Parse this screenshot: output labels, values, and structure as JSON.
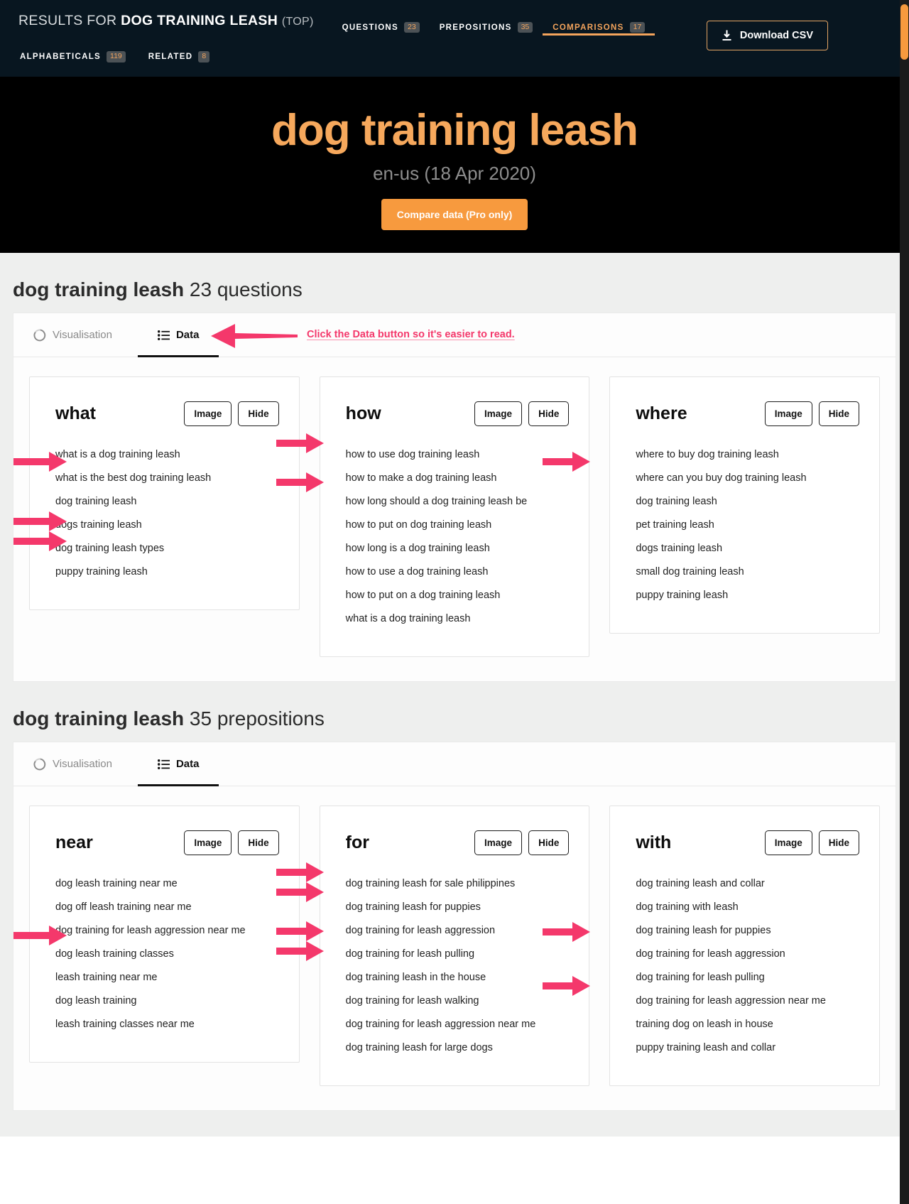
{
  "topbar": {
    "results_prefix": "RESULTS FOR",
    "results_keyword": "DOG TRAINING LEASH",
    "results_suffix": "(TOP)",
    "tabs": [
      {
        "label": "QUESTIONS",
        "count": "23",
        "active": false
      },
      {
        "label": "PREPOSITIONS",
        "count": "35",
        "active": false
      },
      {
        "label": "COMPARISONS",
        "count": "17",
        "active": true
      }
    ],
    "subtabs": [
      {
        "label": "ALPHABETICALS",
        "count": "119"
      },
      {
        "label": "RELATED",
        "count": "8"
      }
    ],
    "download_label": "Download CSV",
    "download_icon": "download-icon",
    "accent_color": "#f4a45c",
    "background_color": "#081620"
  },
  "hero": {
    "title": "dog training leash",
    "locale": "en-us (18 Apr 2020)",
    "compare_label": "Compare data (Pro only)",
    "title_color": "#f6a85c",
    "button_color": "#f79a3e",
    "background_color": "#000000"
  },
  "annotation": {
    "text": "Click the Data button so it's easier to read.",
    "color": "#f4386b"
  },
  "sections": [
    {
      "heading_keyword": "dog training leash",
      "heading_rest": "23 questions",
      "tabs": [
        {
          "label": "Visualisation",
          "icon": "visualisation-icon",
          "active": false
        },
        {
          "label": "Data",
          "icon": "list-icon",
          "active": true
        }
      ],
      "cards": [
        {
          "title": "what",
          "image_label": "Image",
          "hide_label": "Hide",
          "items": [
            "what is a dog training leash",
            "what is the best dog training leash",
            "dog training leash",
            "dogs training leash",
            "dog training leash types",
            "puppy training leash"
          ]
        },
        {
          "title": "how",
          "image_label": "Image",
          "hide_label": "Hide",
          "items": [
            "how to use dog training leash",
            "how to make a dog training leash",
            "how long should a dog training leash be",
            "how to put on dog training leash",
            "how long is a dog training leash",
            "how to use a dog training leash",
            "how to put on a dog training leash",
            "what is a dog training leash"
          ]
        },
        {
          "title": "where",
          "image_label": "Image",
          "hide_label": "Hide",
          "items": [
            "where to buy dog training leash",
            "where can you buy dog training leash",
            "dog training leash",
            "pet training leash",
            "dogs training leash",
            "small dog training leash",
            "puppy training leash"
          ]
        }
      ]
    },
    {
      "heading_keyword": "dog training leash",
      "heading_rest": "35 prepositions",
      "tabs": [
        {
          "label": "Visualisation",
          "icon": "visualisation-icon",
          "active": false
        },
        {
          "label": "Data",
          "icon": "list-icon",
          "active": true
        }
      ],
      "cards": [
        {
          "title": "near",
          "image_label": "Image",
          "hide_label": "Hide",
          "items": [
            "dog leash training near me",
            "dog off leash training near me",
            "dog training for leash aggression near me",
            "dog leash training classes",
            "leash training near me",
            "dog leash training",
            "leash training classes near me"
          ]
        },
        {
          "title": "for",
          "image_label": "Image",
          "hide_label": "Hide",
          "items": [
            "dog training leash for sale philippines",
            "dog training leash for puppies",
            "dog training for leash aggression",
            "dog training for leash pulling",
            "dog training leash in the house",
            "dog training for leash walking",
            "dog training for leash aggression near me",
            "dog training leash for large dogs"
          ]
        },
        {
          "title": "with",
          "image_label": "Image",
          "hide_label": "Hide",
          "items": [
            "dog training leash and collar",
            "dog training with leash",
            "dog training leash for puppies",
            "dog training for leash aggression",
            "dog training for leash pulling",
            "dog training for leash aggression near me",
            "training dog on leash in house",
            "puppy training leash and collar"
          ]
        }
      ]
    }
  ]
}
